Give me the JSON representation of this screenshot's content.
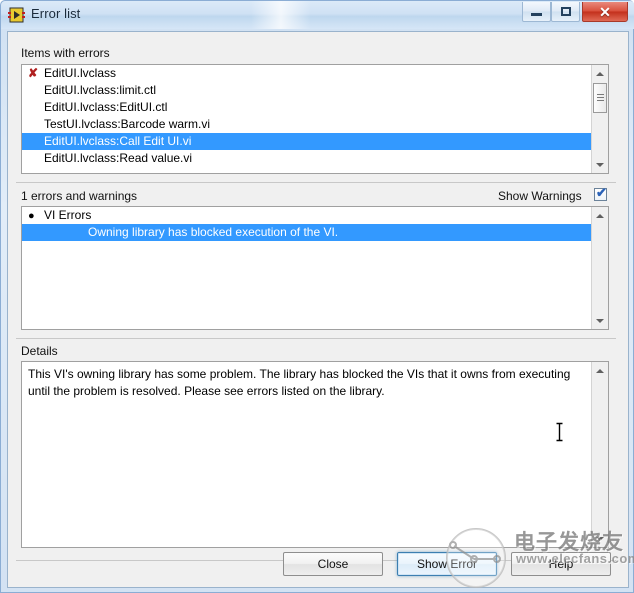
{
  "window": {
    "title": "Error list",
    "icon": "labview-vi-icon",
    "minimize_label": "Minimize",
    "maximize_label": "Maximize",
    "close_label": "✕"
  },
  "items_section": {
    "label": "Items with errors",
    "rows": [
      {
        "text": "EditUI.lvclass",
        "marker": "error",
        "indent": "none",
        "selected": false
      },
      {
        "text": "EditUI.lvclass:limit.ctl",
        "marker": "none",
        "indent": "none",
        "selected": false
      },
      {
        "text": "EditUI.lvclass:EditUI.ctl",
        "marker": "none",
        "indent": "none",
        "selected": false
      },
      {
        "text": "TestUI.lvclass:Barcode warm.vi",
        "marker": "none",
        "indent": "none",
        "selected": false
      },
      {
        "text": "EditUI.lvclass:Call Edit UI.vi",
        "marker": "none",
        "indent": "none",
        "selected": true
      },
      {
        "text": "EditUI.lvclass:Read value.vi",
        "marker": "none",
        "indent": "none",
        "selected": false
      }
    ]
  },
  "errors_section": {
    "label": "1 errors and warnings",
    "show_warnings_label": "Show Warnings",
    "show_warnings_checked": "✔",
    "rows": [
      {
        "text": "VI Errors",
        "marker": "bullet",
        "indent": "none",
        "selected": false
      },
      {
        "text": "Owning library has blocked execution of the VI.",
        "marker": "none",
        "indent": "large",
        "selected": true
      }
    ]
  },
  "details_section": {
    "label": "Details",
    "text": "This VI's owning library has some problem. The library has blocked the VIs that it owns from executing until the problem is resolved. Please see errors listed on the library."
  },
  "buttons": {
    "close": "Close",
    "show_error": "Show Error",
    "help": "Help"
  },
  "watermark": {
    "chinese": "电子发烧友",
    "url": "www.elecfans.com"
  },
  "colors": {
    "selection_blue": "#3399ff",
    "error_red": "#b02020",
    "titlebar_blue": "#cfe1f4",
    "close_red": "#c3301c",
    "focus_ring": "#3c7fb1"
  }
}
